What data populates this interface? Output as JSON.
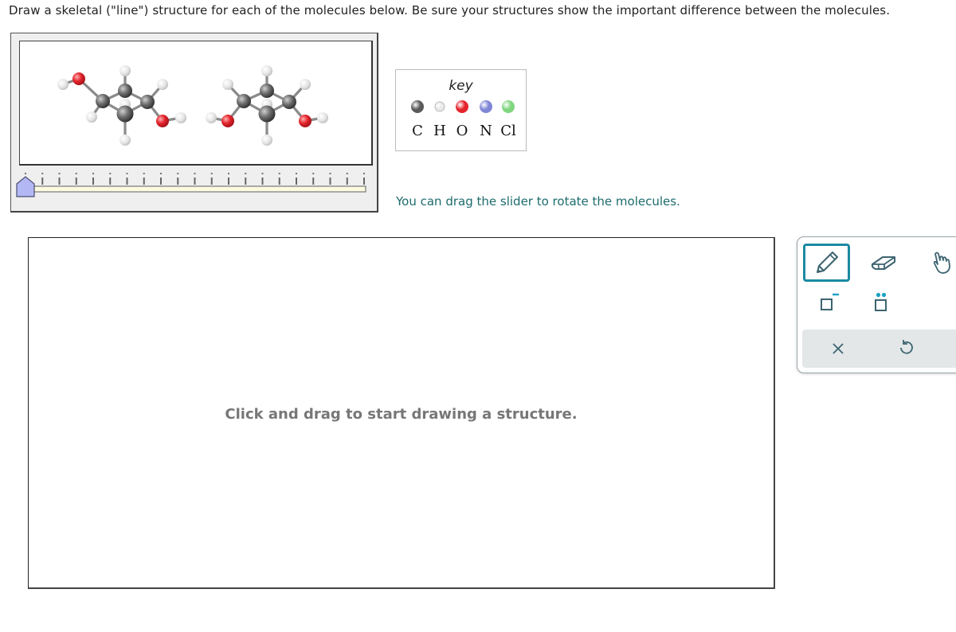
{
  "question": {
    "prompt": "Draw a skeletal (\"line\") structure for each of the molecules below. Be sure your structures show the important difference between the molecules."
  },
  "viewer": {
    "molecules": [
      {
        "name": "molecule-1",
        "atoms": [
          {
            "id": "O1",
            "el": "O"
          },
          {
            "id": "HO1",
            "el": "H"
          },
          {
            "id": "C1",
            "el": "C"
          },
          {
            "id": "H1",
            "el": "H"
          },
          {
            "id": "C2",
            "el": "C"
          },
          {
            "id": "H2",
            "el": "H"
          },
          {
            "id": "C3",
            "el": "C"
          },
          {
            "id": "H3",
            "el": "H"
          },
          {
            "id": "C4",
            "el": "C"
          },
          {
            "id": "H4a",
            "el": "H"
          },
          {
            "id": "H4b",
            "el": "H"
          },
          {
            "id": "O2",
            "el": "O"
          },
          {
            "id": "HO2",
            "el": "H"
          }
        ]
      },
      {
        "name": "molecule-2",
        "atoms": [
          {
            "id": "O1",
            "el": "O"
          },
          {
            "id": "HO1",
            "el": "H"
          },
          {
            "id": "C1",
            "el": "C"
          },
          {
            "id": "H1",
            "el": "H"
          },
          {
            "id": "C2",
            "el": "C"
          },
          {
            "id": "H2",
            "el": "H"
          },
          {
            "id": "C3",
            "el": "C"
          },
          {
            "id": "H3",
            "el": "H"
          },
          {
            "id": "C4",
            "el": "C"
          },
          {
            "id": "H4a",
            "el": "H"
          },
          {
            "id": "H4b",
            "el": "H"
          },
          {
            "id": "O2",
            "el": "O"
          },
          {
            "id": "HO2",
            "el": "H"
          }
        ]
      }
    ],
    "slider": {
      "tick_count": 21,
      "value_fraction": 0.0
    }
  },
  "key": {
    "title": "key",
    "elements": [
      {
        "symbol": "C",
        "color": "#5a5a5a"
      },
      {
        "symbol": "H",
        "color": "#e8e8e8"
      },
      {
        "symbol": "O",
        "color": "#e4242c"
      },
      {
        "symbol": "N",
        "color": "#7f86d6"
      },
      {
        "symbol": "Cl",
        "color": "#7fd67f"
      }
    ]
  },
  "hint": "You can drag the slider to rotate the molecules.",
  "canvas": {
    "placeholder": "Click and drag to start drawing a structure."
  },
  "toolbox": {
    "tools": [
      {
        "name": "pencil",
        "active": true
      },
      {
        "name": "eraser",
        "active": false
      },
      {
        "name": "hand",
        "active": false
      },
      {
        "name": "negative-charge",
        "active": false
      },
      {
        "name": "lone-pair",
        "active": false
      }
    ],
    "actions": [
      {
        "name": "clear"
      },
      {
        "name": "undo"
      }
    ],
    "accent_color": "#1a8aa3",
    "icon_color": "#3d6470"
  }
}
